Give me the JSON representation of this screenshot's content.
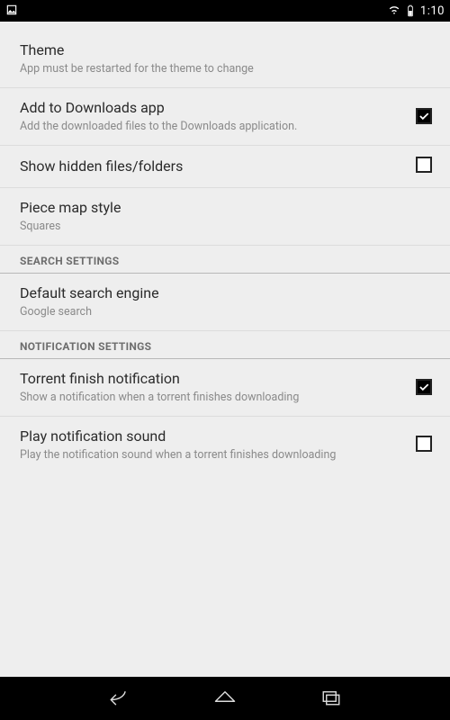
{
  "status": {
    "time": "1:10"
  },
  "settings": {
    "theme": {
      "title": "Theme",
      "subtitle": "App must be restarted for the theme to change"
    },
    "add_downloads": {
      "title": "Add to Downloads app",
      "subtitle": "Add the downloaded files to the Downloads application.",
      "checked": true
    },
    "show_hidden": {
      "title": "Show hidden files/folders",
      "checked": false
    },
    "piece_map": {
      "title": "Piece map style",
      "subtitle": "Squares"
    },
    "section_search": "SEARCH SETTINGS",
    "default_engine": {
      "title": "Default search engine",
      "subtitle": "Google search"
    },
    "section_notif": "NOTIFICATION SETTINGS",
    "torrent_finish": {
      "title": "Torrent finish notification",
      "subtitle": "Show a notification when a torrent finishes downloading",
      "checked": true
    },
    "play_sound": {
      "title": "Play notification sound",
      "subtitle": "Play the notification sound when a torrent finishes downloading",
      "checked": false
    }
  }
}
